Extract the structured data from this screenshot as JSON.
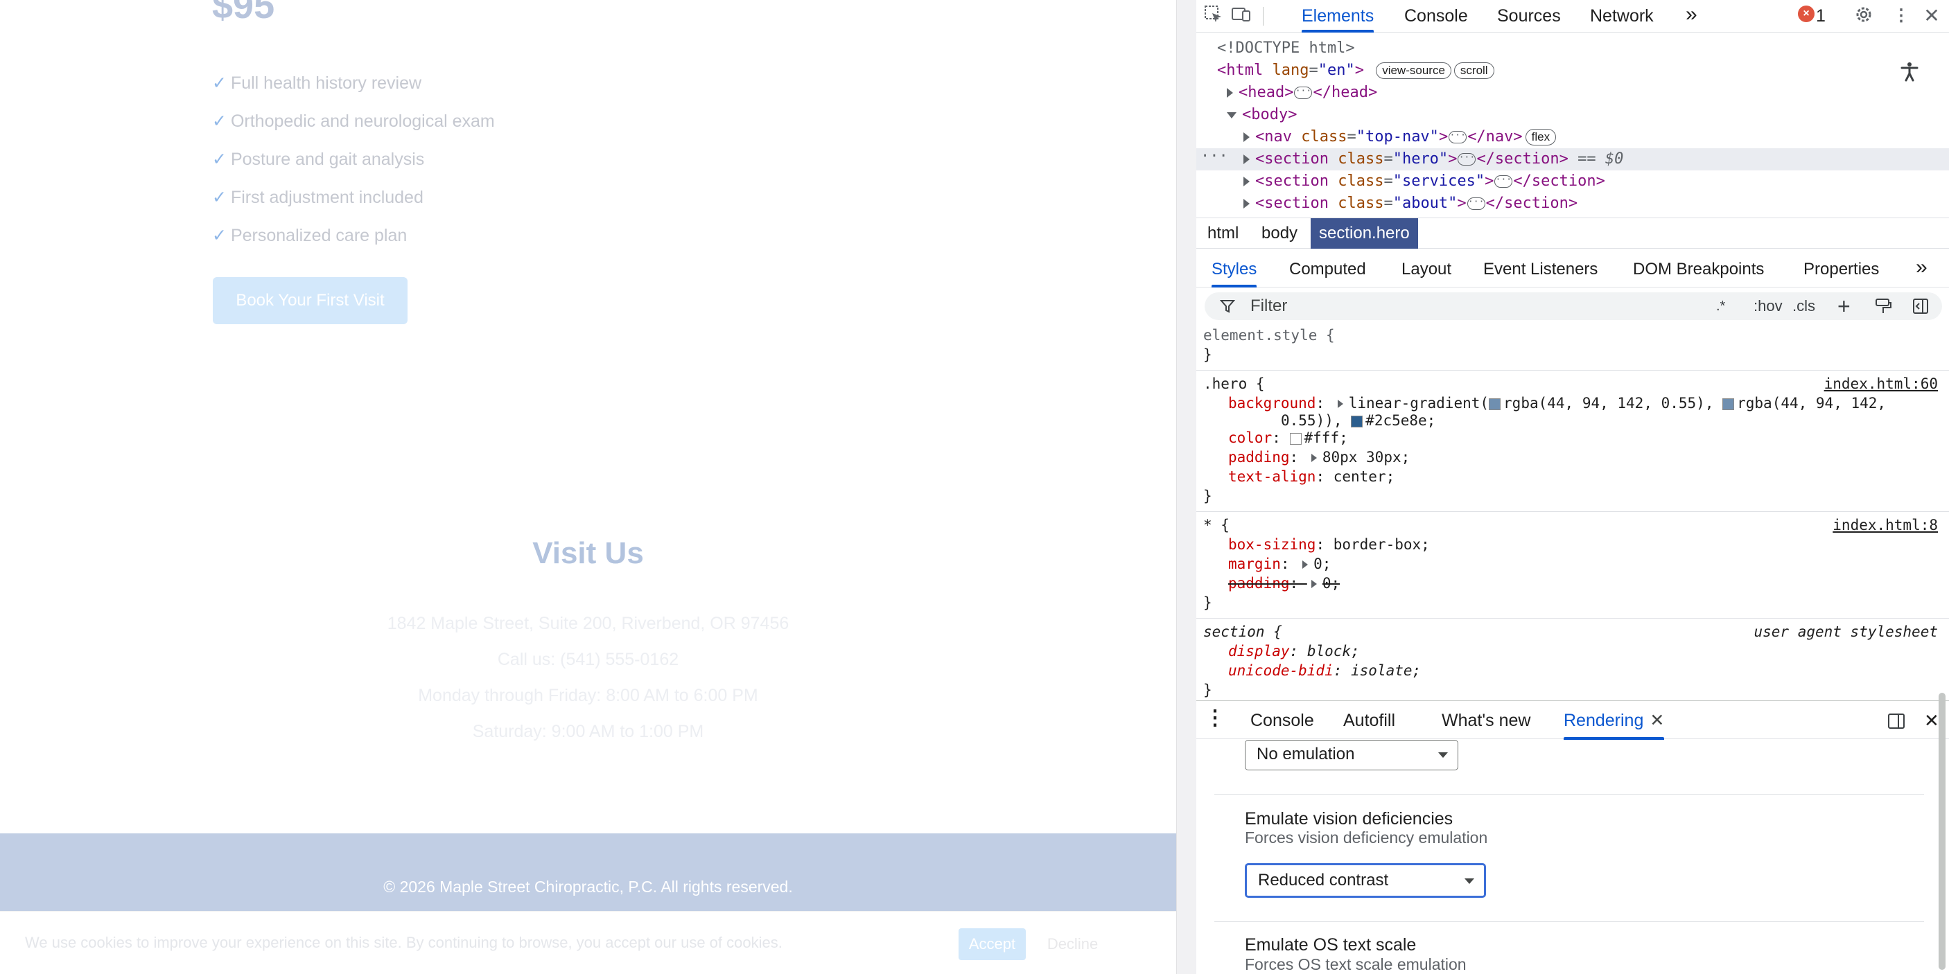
{
  "page": {
    "price": "$95",
    "check_glyph": "✓",
    "features": [
      "Full health history review",
      "Orthopedic and neurological exam",
      "Posture and gait analysis",
      "First adjustment included",
      "Personalized care plan"
    ],
    "cta_label": "Book Your First Visit",
    "visit_title": "Visit Us",
    "visit_lines": [
      "1842 Maple Street, Suite 200, Riverbend, OR 97456",
      "Call us: (541) 555-0162",
      "Monday through Friday: 8:00 AM to 6:00 PM",
      "Saturday: 9:00 AM to 1:00 PM"
    ],
    "footer_text": "© 2026 Maple Street Chiropractic, P.C. All rights reserved.",
    "cookie_text": "We use cookies to improve your experience on this site. By continuing to browse, you accept our use of cookies.",
    "cookie_accept": "Accept",
    "cookie_decline": "Decline"
  },
  "devtools": {
    "main_tabs": [
      "Elements",
      "Console",
      "Sources",
      "Network"
    ],
    "more_tabs": "»",
    "error_count": "1",
    "dom": {
      "doctype": "<!DOCTYPE html>",
      "html_tag": "html",
      "html_attr": "lang",
      "html_val": "\"en\"",
      "badge_view_source": "view-source",
      "badge_scroll": "scroll",
      "head_open": "<head>",
      "head_close": "</head>",
      "body_open": "<body>",
      "nav_tag": "<nav",
      "nav_attr": "class",
      "nav_val": "\"top-nav\"",
      "nav_close": "</nav>",
      "badge_flex": "flex",
      "hero_tag": "<section",
      "hero_attr": "class",
      "hero_val": "\"hero\"",
      "hero_close": "</section>",
      "hero_eq": "== $0",
      "services_tag": "<section",
      "services_attr": "class",
      "services_val": "\"services\"",
      "services_close": "</section>",
      "about_tag": "<section",
      "about_attr": "class",
      "about_val": "\"about\"",
      "about_close": "</section>"
    },
    "breadcrumbs": [
      "html",
      "body",
      "section.hero"
    ],
    "style_tabs": [
      "Styles",
      "Computed",
      "Layout",
      "Event Listeners",
      "DOM Breakpoints",
      "Properties"
    ],
    "filter_placeholder": "Filter",
    "filter_tools": [
      ".*",
      ":hov",
      ".cls"
    ],
    "rules": {
      "element_style": "element.style {",
      "close": "}",
      "hero_selector": ".hero {",
      "hero_source": "index.html:60",
      "hero_bg_prop": "background",
      "hero_bg_val1": "linear-gradient(",
      "hero_bg_c1": "rgba(44, 94, 142, 0.55),",
      "hero_bg_c2": "rgba(44, 94, 142,",
      "hero_bg_val2": "0.55)),",
      "hero_bg_c3": "#2c5e8e;",
      "hero_color_prop": "color",
      "hero_color_val": "#fff;",
      "hero_pad_prop": "padding",
      "hero_pad_val": "80px 30px;",
      "hero_align_prop": "text-align",
      "hero_align_val": "center;",
      "star_selector": "* {",
      "star_source": "index.html:8",
      "star_box_prop": "box-sizing",
      "star_box_val": "border-box;",
      "star_margin_prop": "margin",
      "star_margin_val": "0;",
      "star_pad_prop": "padding",
      "star_pad_val": "0;",
      "section_selector": "section {",
      "section_source": "user agent stylesheet",
      "sec_display_prop": "display",
      "sec_display_val": "block;",
      "sec_bidi_prop": "unicode-bidi",
      "sec_bidi_val": "isolate;"
    },
    "drawer_tabs": [
      "Console",
      "Autofill",
      "What's new",
      "Rendering"
    ],
    "rendering": {
      "emulation_value": "No emulation",
      "vision_title": "Emulate vision deficiencies",
      "vision_sub": "Forces vision deficiency emulation",
      "vision_value": "Reduced contrast",
      "os_title": "Emulate OS text scale",
      "os_sub": "Forces OS text scale emulation"
    },
    "colors": {
      "accent": "#0b57d0",
      "swatch_rgba": "#6f8fb0",
      "swatch_hex": "#2c5e8e",
      "swatch_white": "#ffffff",
      "error": "#e0553f"
    }
  }
}
